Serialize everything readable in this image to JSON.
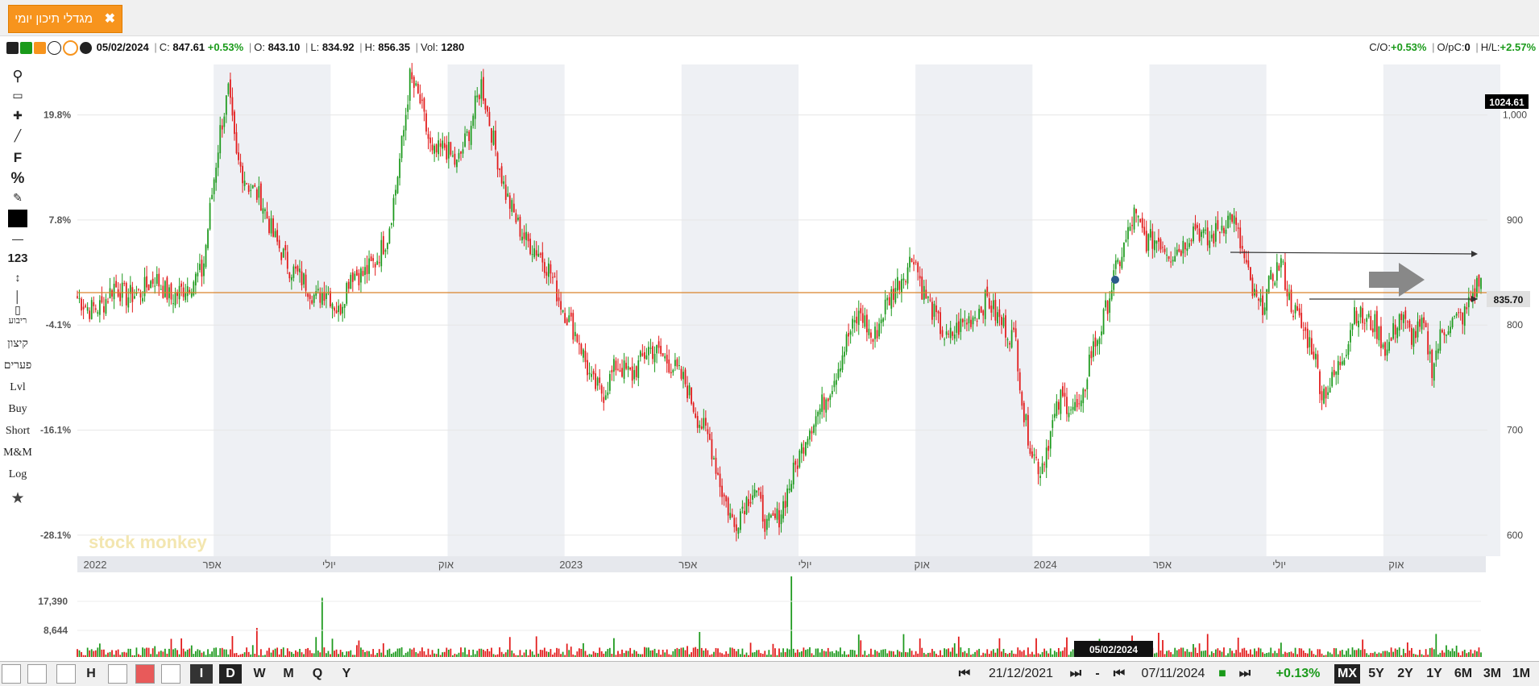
{
  "tab": {
    "title": "מגדלי תיכון יומי",
    "close": "✖"
  },
  "info": {
    "date": "05/02/2024",
    "c_label": "C:",
    "c_value": "847.61",
    "c_change": "+0.53%",
    "o_label": "O:",
    "o_value": "843.10",
    "l_label": "L:",
    "l_value": "834.92",
    "h_label": "H:",
    "h_value": "856.35",
    "vol_label": "Vol:",
    "vol_value": "1280",
    "co_label": "C/O:",
    "co_value": "+0.53%",
    "opc_label": "O/pC:",
    "opc_value": "0",
    "hl_label": "H/L:",
    "hl_value": "+2.57%"
  },
  "toolbar": {
    "items": [
      "קיצון",
      "פערים",
      "Lvl",
      "Buy",
      "Short",
      "M&M",
      "Log"
    ],
    "f_label": "F",
    "pct_label": "%",
    "num_label": "123",
    "candle_label": "ריבוע"
  },
  "watermark": "stock monkey",
  "chart_data": {
    "type": "candlestick",
    "price_axis_right": {
      "ticks": [
        1000,
        900,
        800,
        700,
        600
      ],
      "ticklabels": [
        "1,000",
        "900",
        "800",
        "700",
        "600"
      ],
      "ylim": [
        580,
        1048
      ]
    },
    "pct_axis_left": {
      "ticks": [
        "19.8%",
        "7.8%",
        "-4.1%",
        "-16.1%",
        "-28.1%"
      ]
    },
    "x_ticklabels": [
      "2022",
      "אפר",
      "יולי",
      "אוק",
      "2023",
      "אפר",
      "יולי",
      "אוק",
      "2024",
      "אפר",
      "יולי",
      "אוק"
    ],
    "x_range": [
      "21/12/2021",
      "07/11/2024"
    ],
    "max_label": "1024.61",
    "last_price_label": "835.70",
    "reference_level": 835.7,
    "close_path": [
      [
        0,
        826
      ],
      [
        6,
        815
      ],
      [
        12,
        818
      ],
      [
        18,
        838
      ],
      [
        24,
        827
      ],
      [
        31,
        831
      ],
      [
        38,
        845
      ],
      [
        46,
        825
      ],
      [
        54,
        838
      ],
      [
        61,
        850
      ],
      [
        62,
        860
      ],
      [
        66,
        925
      ],
      [
        70,
        985
      ],
      [
        74,
        1022
      ],
      [
        78,
        958
      ],
      [
        84,
        933
      ],
      [
        90,
        920
      ],
      [
        96,
        885
      ],
      [
        104,
        855
      ],
      [
        112,
        840
      ],
      [
        117,
        825
      ],
      [
        122,
        835
      ],
      [
        128,
        812
      ],
      [
        134,
        850
      ],
      [
        140,
        848
      ],
      [
        146,
        860
      ],
      [
        152,
        885
      ],
      [
        156,
        930
      ],
      [
        160,
        985
      ],
      [
        163,
        1035
      ],
      [
        168,
        1012
      ],
      [
        174,
        960
      ],
      [
        180,
        970
      ],
      [
        186,
        952
      ],
      [
        192,
        985
      ],
      [
        198,
        1030
      ],
      [
        204,
        975
      ],
      [
        210,
        925
      ],
      [
        216,
        895
      ],
      [
        220,
        880
      ],
      [
        226,
        870
      ],
      [
        232,
        850
      ],
      [
        236,
        825
      ],
      [
        240,
        808
      ],
      [
        246,
        785
      ],
      [
        252,
        745
      ],
      [
        258,
        735
      ],
      [
        264,
        762
      ],
      [
        272,
        752
      ],
      [
        280,
        778
      ],
      [
        286,
        772
      ],
      [
        292,
        760
      ],
      [
        298,
        745
      ],
      [
        304,
        712
      ],
      [
        310,
        690
      ],
      [
        316,
        642
      ],
      [
        322,
        608
      ],
      [
        326,
        628
      ],
      [
        332,
        645
      ],
      [
        338,
        608
      ],
      [
        344,
        618
      ],
      [
        352,
        665
      ],
      [
        358,
        700
      ],
      [
        364,
        720
      ],
      [
        370,
        745
      ],
      [
        378,
        790
      ],
      [
        384,
        812
      ],
      [
        390,
        785
      ],
      [
        396,
        818
      ],
      [
        402,
        840
      ],
      [
        406,
        852
      ],
      [
        410,
        868
      ],
      [
        414,
        835
      ],
      [
        420,
        810
      ],
      [
        426,
        785
      ],
      [
        432,
        798
      ],
      [
        440,
        810
      ],
      [
        446,
        825
      ],
      [
        450,
        810
      ],
      [
        455,
        797
      ],
      [
        460,
        785
      ],
      [
        464,
        712
      ],
      [
        468,
        680
      ],
      [
        472,
        662
      ],
      [
        478,
        705
      ],
      [
        482,
        730
      ],
      [
        488,
        722
      ],
      [
        492,
        718
      ],
      [
        496,
        768
      ],
      [
        502,
        798
      ],
      [
        508,
        845
      ],
      [
        514,
        880
      ],
      [
        518,
        905
      ],
      [
        524,
        880
      ],
      [
        530,
        882
      ],
      [
        536,
        868
      ],
      [
        542,
        876
      ],
      [
        548,
        895
      ],
      [
        554,
        878
      ],
      [
        560,
        893
      ],
      [
        566,
        905
      ],
      [
        572,
        862
      ],
      [
        576,
        830
      ],
      [
        580,
        815
      ],
      [
        586,
        847
      ],
      [
        590,
        860
      ],
      [
        594,
        825
      ],
      [
        600,
        798
      ],
      [
        606,
        776
      ],
      [
        610,
        735
      ],
      [
        614,
        742
      ],
      [
        618,
        760
      ],
      [
        622,
        780
      ],
      [
        626,
        815
      ],
      [
        630,
        805
      ],
      [
        636,
        800
      ],
      [
        642,
        775
      ],
      [
        648,
        810
      ],
      [
        654,
        790
      ],
      [
        660,
        798
      ],
      [
        664,
        760
      ],
      [
        668,
        788
      ],
      [
        672,
        802
      ],
      [
        676,
        805
      ],
      [
        680,
        810
      ],
      [
        684,
        830
      ],
      [
        688,
        845
      ]
    ],
    "volume_axis": {
      "ticks": [
        "17,390",
        "8,644"
      ]
    },
    "crosshair_date": "05/02/2024"
  },
  "bottom": {
    "left_buttons": [
      "I",
      "D",
      "W",
      "M",
      "Q",
      "Y"
    ],
    "h_label": "H",
    "start_date": "21/12/2021",
    "dash": "-",
    "end_date": "07/11/2024",
    "change": "+0.13%",
    "ranges": [
      "MX",
      "5Y",
      "2Y",
      "1Y",
      "6M",
      "3M",
      "1M"
    ]
  },
  "colors": {
    "up": "#1e9a1e",
    "down": "#e21b1b",
    "tab": "#f7941d",
    "level": "#d9822b",
    "band": "#eef0f4"
  }
}
